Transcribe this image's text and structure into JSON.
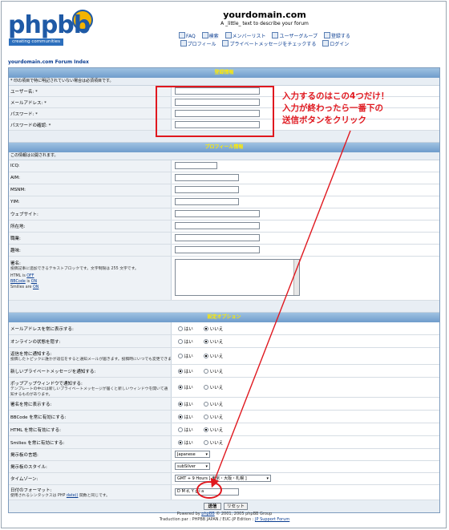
{
  "header": {
    "logo_text": "phpbb",
    "logo_sub": "creating communities",
    "site_title": "yourdomain.com",
    "site_desc": "A _little_ text to describe your forum",
    "nav_row1": [
      "FAQ",
      "検索",
      "メンバーリスト",
      "ユーザーグループ",
      "登録する"
    ],
    "nav_row2": [
      "プロフィール",
      "プライベートメッセージをチェックする",
      "ログイン"
    ]
  },
  "breadcrumb": "yourdomain.com Forum Index",
  "sections": {
    "registration_title": "登録情報",
    "registration_note": "* 印の項目で特に明記されていない場合は必須項目です。",
    "profile_title": "プロフィール情報",
    "profile_note": "この情報は公開されます。",
    "options_title": "設定オプション"
  },
  "registration_fields": [
    "ユーザー名: *",
    "メールアドレス: *",
    "パスワード: *",
    "パスワードの確認: *"
  ],
  "profile_fields": [
    "ICQ:",
    "AIM:",
    "MSNM:",
    "YIM:",
    "ウェブサイト:",
    "所在地:",
    "職業:",
    "趣味:"
  ],
  "signature": {
    "label": "署名:",
    "desc": "投稿記事に追加できるテキストブロックです。文字制限は 255 文字です。",
    "html_label": "HTML is",
    "html_state": "OFF",
    "bbcode_label": "BBCode",
    "bbcode_is": "is",
    "bbcode_state": "ON",
    "smilies_label": "Smilies are",
    "smilies_state": "ON"
  },
  "radio_yes": "はい",
  "radio_no": "いいえ",
  "options": [
    {
      "label": "メールアドレスを常に表示する:",
      "sub": "",
      "selected": "no"
    },
    {
      "label": "オンラインの状態を隠す:",
      "sub": "",
      "selected": "no"
    },
    {
      "label": "返信を常に通知する:",
      "sub": "投稿したトピックに誰かが返信をすると通知メールが届きます。投稿時にいつでも変更できます。",
      "selected": "no"
    },
    {
      "label": "新しいプライベートメッセージを通知する:",
      "sub": "",
      "selected": "yes"
    },
    {
      "label": "ポップアップウィンドウで通知する:",
      "sub": "テンプレートの中には新しいプライベートメッセージが届くと新しいウィンドウを開いて通知するものがあります。",
      "selected": "yes"
    },
    {
      "label": "署名を常に表示する:",
      "sub": "",
      "selected": "yes"
    },
    {
      "label": "BBCode を常に有効にする:",
      "sub": "",
      "selected": "yes"
    },
    {
      "label": "HTML を常に有効にする:",
      "sub": "",
      "selected": "no"
    },
    {
      "label": "Smilies を常に有効にする:",
      "sub": "",
      "selected": "yes"
    }
  ],
  "selects": {
    "language_label": "掲示板の言語:",
    "language_value": "Japanese",
    "style_label": "掲示板のスタイル:",
    "style_value": "subSilver",
    "timezone_label": "タイムゾーン:",
    "timezone_value": "GMT + 9 Hours [ 東京・大阪・札幌 ]",
    "dateformat_label": "日付のフォーマット:",
    "dateformat_desc_pre": "使用されるシンタックスは PHP",
    "dateformat_link": "date()",
    "dateformat_desc_post": "関数と同じです。",
    "dateformat_value": "D M d, Y g:i a"
  },
  "buttons": {
    "submit": "送信",
    "reset": "リセット"
  },
  "annotation": {
    "line1": "入力するのはこの4つだけ！",
    "line2": "入力が終わったら一番下の",
    "line3": "送信ボタンをクリック"
  },
  "footer": {
    "line1_pre": "Powered by",
    "line1_link": "phpBB",
    "line1_post": "© 2001, 2005 phpBB Group",
    "line2_pre": "Traduction par : PHPBB JAPAN / EUC-JP Edition :",
    "line2_link": "JP Support Forum"
  },
  "colors": {
    "annotation": "#e0181f",
    "section_head_text": "#ffea00",
    "link": "#0a3d91"
  }
}
